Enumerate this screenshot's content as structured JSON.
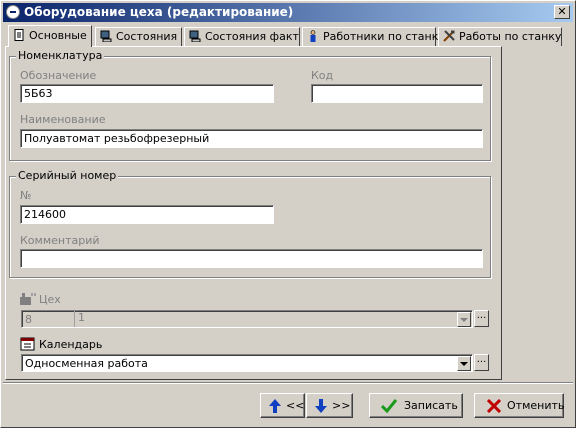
{
  "window": {
    "title": "Оборудование цеха (редактирование)"
  },
  "tabs": [
    {
      "label": "Основные",
      "icon": "document-icon"
    },
    {
      "label": "Состояния",
      "icon": "computer-icon"
    },
    {
      "label": "Состояния факт",
      "icon": "computer-icon"
    },
    {
      "label": "Работники по станку",
      "icon": "person-icon"
    },
    {
      "label": "Работы по станку",
      "icon": "tools-icon"
    }
  ],
  "nomenclature": {
    "title": "Номенклатура",
    "designation_label": "Обозначение",
    "designation_value": "5Б63",
    "code_label": "Код",
    "code_value": "",
    "name_label": "Наименование",
    "name_value": "Полуавтомат резьбофрезерный"
  },
  "serial": {
    "title": "Серийный номер",
    "number_label": "№",
    "number_value": "214600",
    "comment_label": "Комментарий",
    "comment_value": ""
  },
  "workshop": {
    "label": "Цех",
    "code": "8",
    "name": "1",
    "dots": "..."
  },
  "calendar": {
    "label": "Календарь",
    "value": "Односменная работа",
    "dots": "..."
  },
  "buttons": {
    "prev": "<<",
    "next": ">>",
    "save": "Записать",
    "cancel": "Отменить"
  },
  "colors": {
    "titlebar_start": "#0a246a",
    "titlebar_end": "#a6caf0",
    "face": "#d4d0c8",
    "save_check": "#1a9a1a",
    "cancel_x": "#c00000",
    "arrow": "#1040c0"
  }
}
